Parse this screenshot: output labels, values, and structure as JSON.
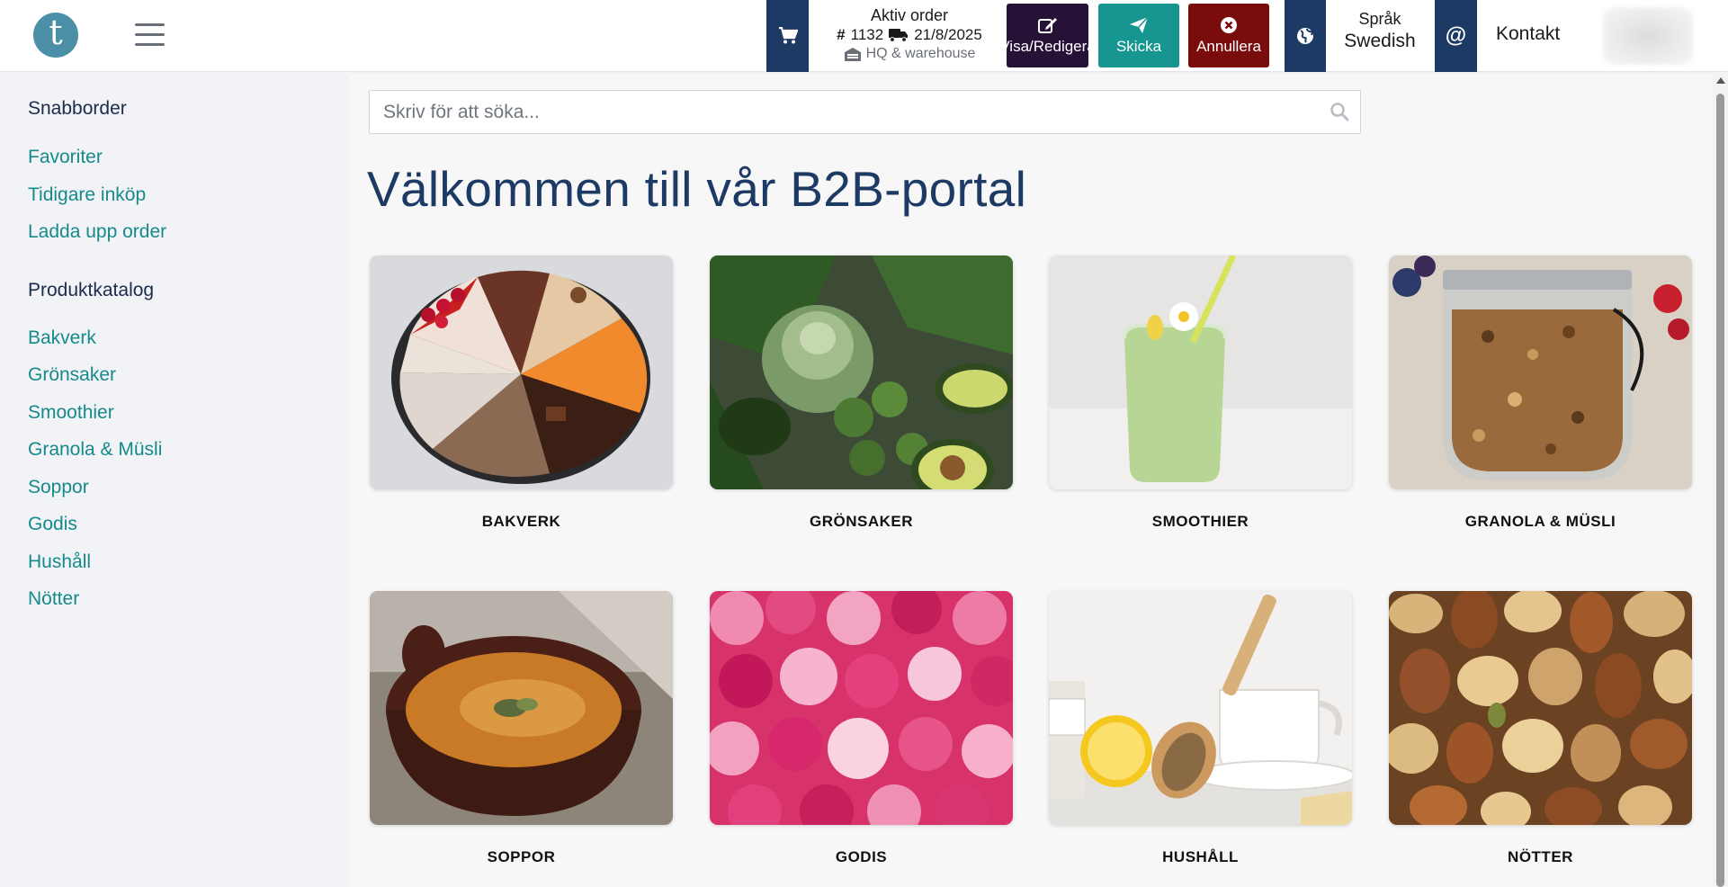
{
  "header": {
    "logo_letter": "t",
    "active_order": {
      "title": "Aktiv order",
      "number_symbol": "#",
      "number": "1132",
      "date": "21/8/2025",
      "warehouse": "HQ & warehouse"
    },
    "buttons": {
      "edit": "Visa/Redigera",
      "send": "Skicka",
      "cancel": "Annullera"
    },
    "language": {
      "label": "Språk",
      "value": "Swedish"
    },
    "contact": {
      "symbol": "@",
      "label": "Kontakt"
    }
  },
  "sidebar": {
    "quick_heading": "Snabborder",
    "quick_links": [
      "Favoriter",
      "Tidigare inköp",
      "Ladda upp order"
    ],
    "catalog_heading": "Produktkatalog",
    "catalog_links": [
      "Bakverk",
      "Grönsaker",
      "Smoothier",
      "Granola & Müsli",
      "Soppor",
      "Godis",
      "Hushåll",
      "Nötter"
    ]
  },
  "search": {
    "placeholder": "Skriv för att söka..."
  },
  "main": {
    "welcome": "Välkommen till vår B2B-portal",
    "categories": [
      {
        "label": "BAKVERK",
        "image": "cake-slices-image"
      },
      {
        "label": "GRÖNSAKER",
        "image": "vegetables-image"
      },
      {
        "label": "SMOOTHIER",
        "image": "smoothie-glass-image"
      },
      {
        "label": "GRANOLA & MÜSLI",
        "image": "granola-jar-image"
      },
      {
        "label": "SOPPOR",
        "image": "soup-bowl-image"
      },
      {
        "label": "GODIS",
        "image": "candy-image"
      },
      {
        "label": "HUSHÅLL",
        "image": "cleaning-brush-image"
      },
      {
        "label": "NÖTTER",
        "image": "mixed-nuts-image"
      }
    ]
  },
  "colors": {
    "navy": "#1c3a63",
    "teal_link": "#168a8a",
    "edit_button": "#261137",
    "send_button": "#169591",
    "cancel_button": "#7a0c0c"
  },
  "icons": [
    "cart-icon",
    "truck-icon",
    "warehouse-icon",
    "edit-icon",
    "send-icon",
    "cancel-icon",
    "globe-icon",
    "search-icon",
    "hamburger-icon"
  ]
}
